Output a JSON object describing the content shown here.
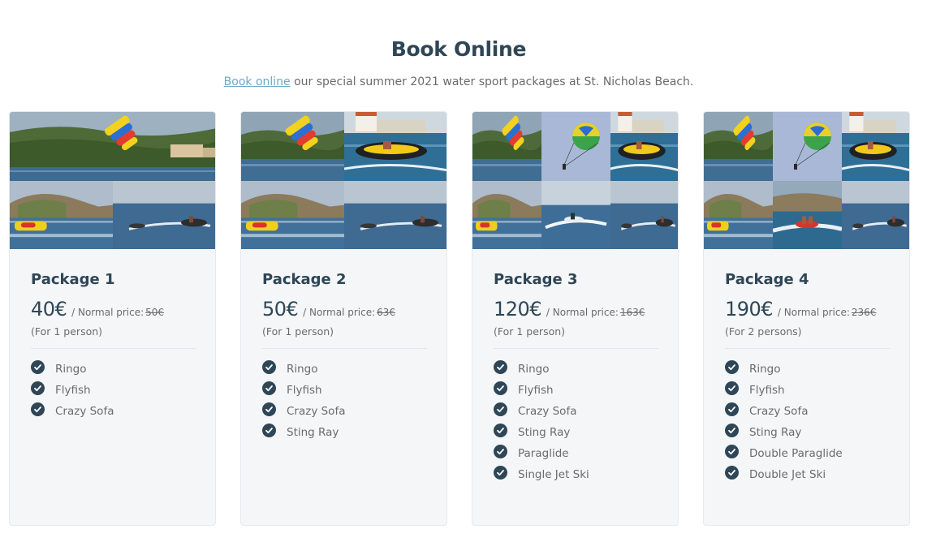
{
  "header": {
    "title": "Book Online",
    "subtitle_link": "Book online",
    "subtitle_rest": " our special summer 2021 water sport packages at St. Nicholas Beach."
  },
  "colors": {
    "accent": "#2e4656",
    "link": "#71a8c4",
    "card_bg": "#f4f6f8",
    "text_muted": "#6b6b6b"
  },
  "packages": [
    {
      "name": "Package 1",
      "price": "40€",
      "normal_label": " / Normal price:",
      "normal_price": "50€",
      "persons": "(For 1 person)",
      "features": [
        "Ringo",
        "Flyfish",
        "Crazy Sofa"
      ]
    },
    {
      "name": "Package 2",
      "price": "50€",
      "normal_label": " / Normal price:",
      "normal_price": "63€",
      "persons": "(For 1 person)",
      "features": [
        "Ringo",
        "Flyfish",
        "Crazy Sofa",
        "Sting Ray"
      ]
    },
    {
      "name": "Package 3",
      "price": "120€",
      "normal_label": " / Normal price:",
      "normal_price": "163€",
      "persons": "(For 1 person)",
      "features": [
        "Ringo",
        "Flyfish",
        "Crazy Sofa",
        "Sting Ray",
        "Paraglide",
        "Single Jet Ski"
      ]
    },
    {
      "name": "Package 4",
      "price": "190€",
      "normal_label": " / Normal price:",
      "normal_price": "236€",
      "persons": "(For 2 persons)",
      "features": [
        "Ringo",
        "Flyfish",
        "Crazy Sofa",
        "Sting Ray",
        "Double Paraglide",
        "Double Jet Ski"
      ]
    }
  ],
  "icons": {
    "feature_check": "check-circle-icon"
  }
}
